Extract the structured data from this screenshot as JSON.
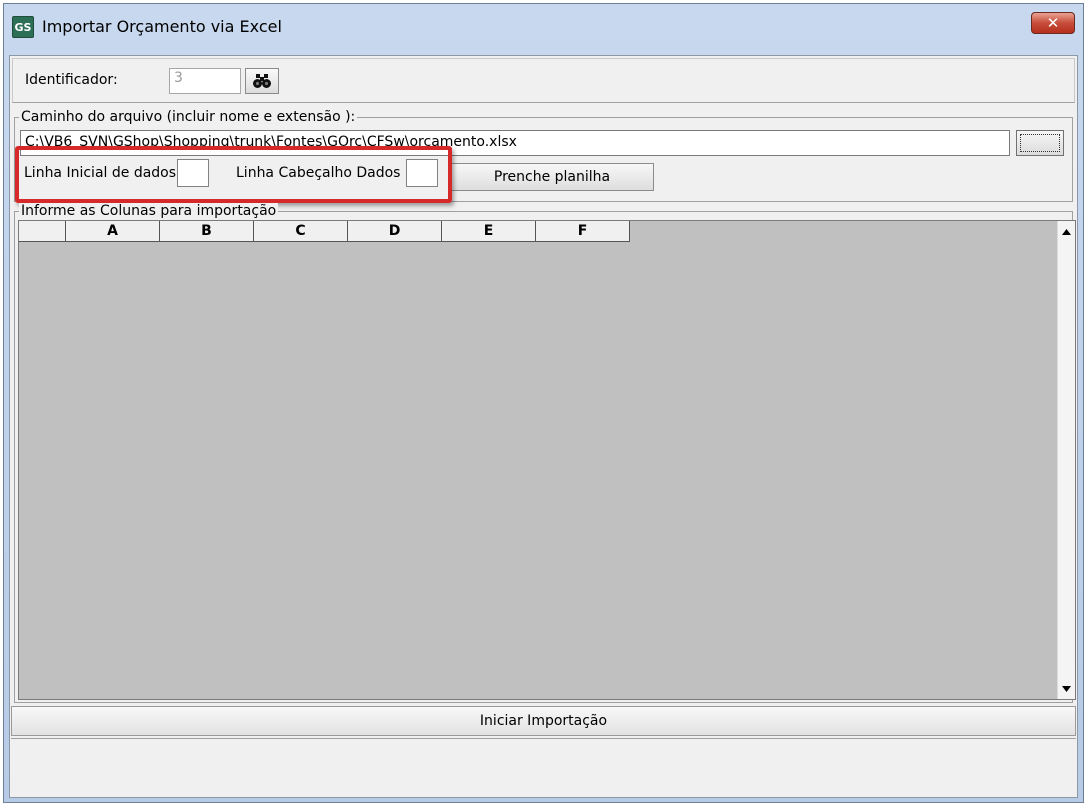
{
  "window": {
    "title": "Importar Orçamento via Excel",
    "app_icon_text": "GS",
    "close_symbol": "✕"
  },
  "identifier": {
    "label": "Identificador:",
    "value": "3",
    "search_icon": "binoculars-icon"
  },
  "file_group": {
    "legend": "Caminho do arquivo (incluir nome e extensão ):",
    "path": "C:\\VB6_SVN\\GShop\\Shopping\\trunk\\Fontes\\GOrc\\CFSw\\orcamento.xlsx",
    "browse_label": "...",
    "start_row_label": "Linha Inicial de dados",
    "start_row_value": "",
    "header_row_label": "Linha Cabeçalho Dados",
    "header_row_value": "",
    "fill_button": "Prenche planilha"
  },
  "columns_group": {
    "legend": "Informe as Colunas para importação",
    "columns": [
      "A",
      "B",
      "C",
      "D",
      "E",
      "F"
    ]
  },
  "actions": {
    "start_import": "Iniciar Importação"
  },
  "colors": {
    "highlight": "#d62929",
    "grid_background": "#c0c0c0",
    "titlebar": "#c8d9ef",
    "close_button": "#c74d3a"
  }
}
